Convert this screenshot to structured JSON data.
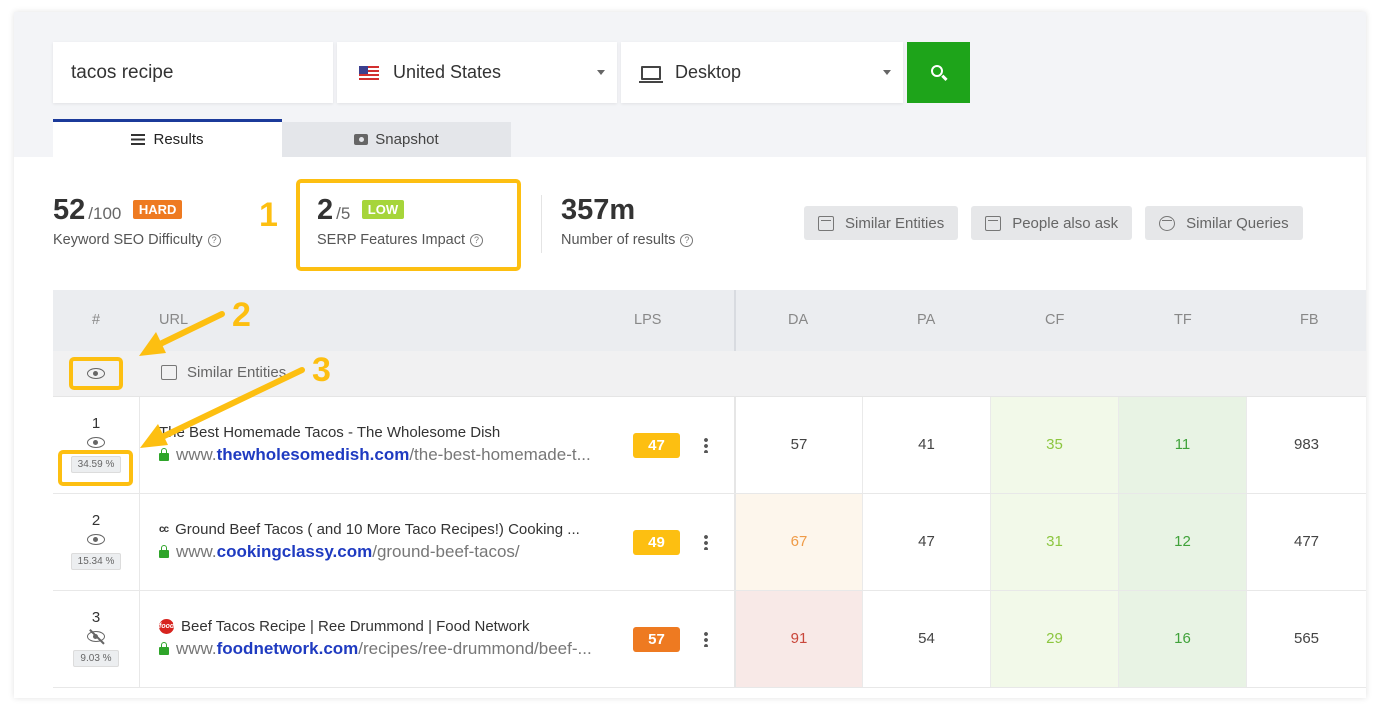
{
  "search": {
    "keyword": "tacos recipe",
    "location": "United States",
    "device": "Desktop"
  },
  "icons": {
    "flag": "us-flag-icon",
    "device": "monitor-icon",
    "search": "search-icon",
    "results_tab": "list-icon",
    "snapshot_tab": "camera-icon",
    "visibility": "eye-icon",
    "visibility_off": "eye-slash-icon",
    "secure": "lock-icon",
    "more": "kebab-menu-icon",
    "help": "help-circle-icon"
  },
  "tabs": {
    "results": "Results",
    "snapshot": "Snapshot"
  },
  "metrics": {
    "difficulty": {
      "value": "52",
      "max": "/100",
      "badge": "HARD",
      "label": "Keyword SEO Difficulty"
    },
    "serp": {
      "value": "2",
      "max": "/5",
      "badge": "LOW",
      "label": "SERP Features Impact"
    },
    "results": {
      "value": "357m",
      "label": "Number of results"
    }
  },
  "buttons": {
    "similar_entities": "Similar Entities",
    "people_also_ask": "People also ask",
    "similar_queries": "Similar Queries"
  },
  "annotations": {
    "a1": "1",
    "a2": "2",
    "a3": "3"
  },
  "table": {
    "headers": {
      "num": "#",
      "url": "URL",
      "lps": "LPS",
      "da": "DA",
      "pa": "PA",
      "cf": "CF",
      "tf": "TF",
      "fb": "FB"
    },
    "subheader": "Similar Entities",
    "rows": [
      {
        "rank": "1",
        "share": "34.59 %",
        "favicon": "",
        "title": "The Best Homemade Tacos - The Wholesome Dish",
        "url_prefix": "www.",
        "domain": "thewholesomedish.com",
        "path": "/the-best-homemade-t...",
        "lps": "47",
        "da": "57",
        "pa": "41",
        "cf": "35",
        "tf": "11",
        "fb": "983"
      },
      {
        "rank": "2",
        "share": "15.34 %",
        "favicon": "cc",
        "title": "Ground Beef Tacos ( and 10 More Taco Recipes!) Cooking ...",
        "url_prefix": "www.",
        "domain": "cookingclassy.com",
        "path": "/ground-beef-tacos/",
        "lps": "49",
        "da": "67",
        "pa": "47",
        "cf": "31",
        "tf": "12",
        "fb": "477"
      },
      {
        "rank": "3",
        "share": "9.03 %",
        "favicon": "food",
        "title": "Beef Tacos Recipe | Ree Drummond | Food Network",
        "url_prefix": "www.",
        "domain": "foodnetwork.com",
        "path": "/recipes/ree-drummond/beef-...",
        "lps": "57",
        "da": "91",
        "pa": "54",
        "cf": "29",
        "tf": "16",
        "fb": "565"
      }
    ]
  },
  "colors": {
    "search_button": "#1ea41a",
    "badge_hard": "#ee7a21",
    "badge_low": "#a6d53a",
    "annotation": "#fdbf11",
    "lps_47": "#fdbf11",
    "lps_49": "#fdbf11",
    "lps_57": "#ee7a21",
    "da_67_bg": "#fdf6ec",
    "da_67_fg": "#ef9b47",
    "da_91_bg": "#f8e9e7",
    "da_91_fg": "#c9463a",
    "domain_link": "#1f3bc1"
  }
}
